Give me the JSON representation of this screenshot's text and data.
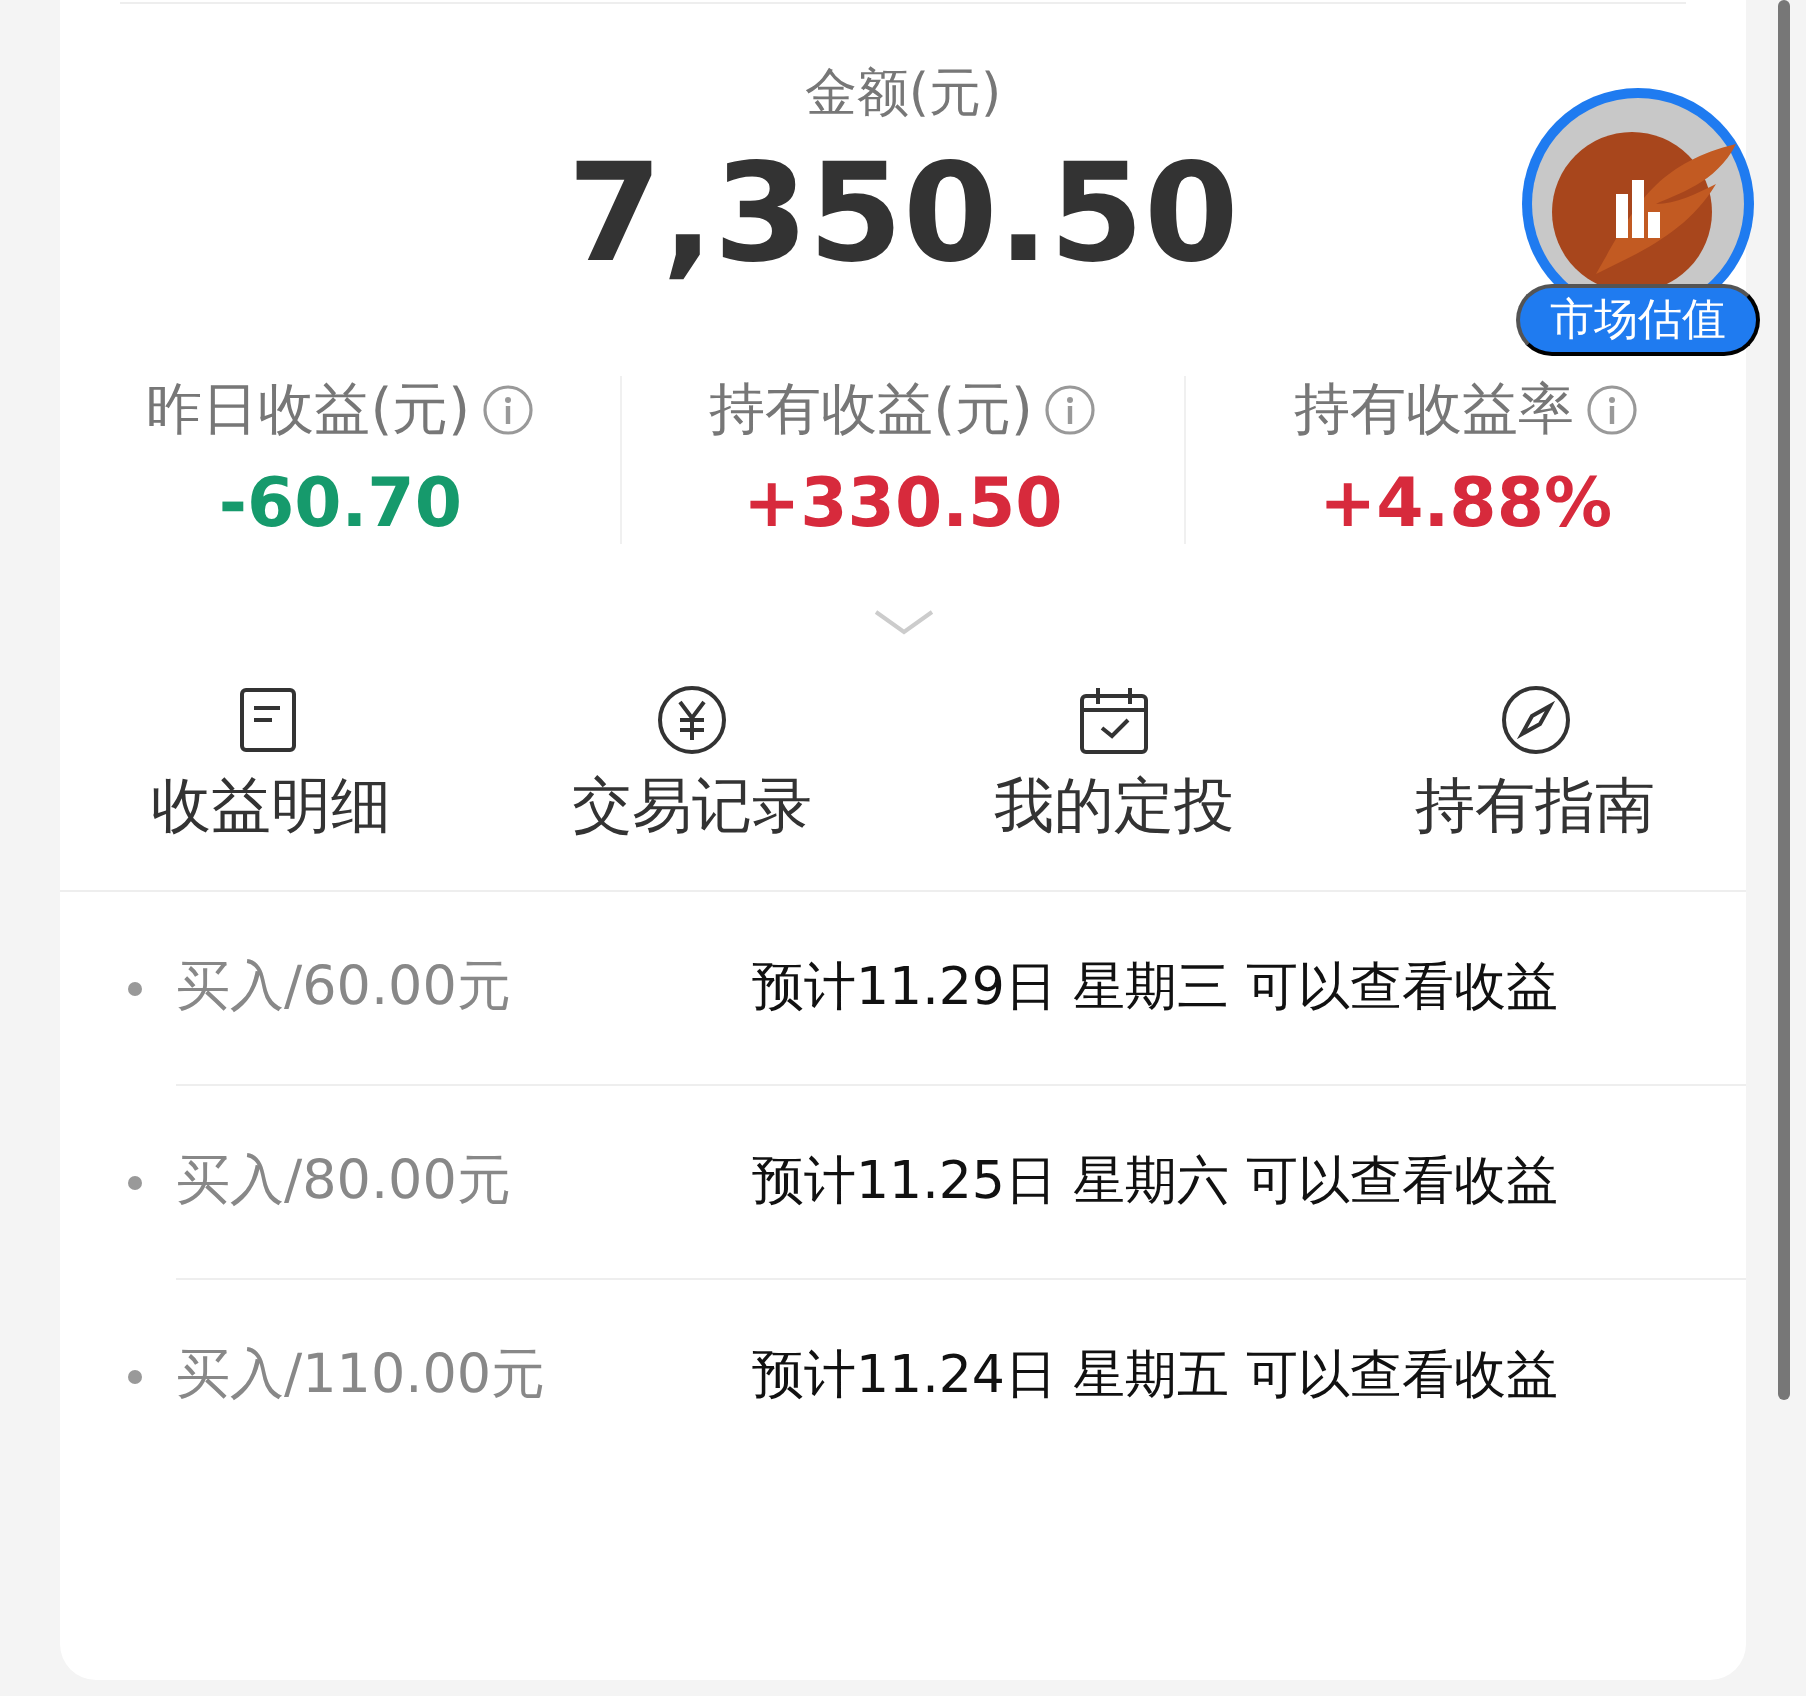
{
  "amount": {
    "label": "金额(元)",
    "value": "7,350.50"
  },
  "badge": {
    "label": "市场估值"
  },
  "stats": [
    {
      "label": "昨日收益(元)",
      "value": "-60.70",
      "color": "#169a6c"
    },
    {
      "label": "持有收益(元)",
      "value": "+330.50",
      "color": "#d72a3c"
    },
    {
      "label": "持有收益率",
      "value": "+4.88%",
      "color": "#d72a3c"
    }
  ],
  "actions": [
    {
      "label": "收益明细",
      "kind": "document"
    },
    {
      "label": "交易记录",
      "kind": "yen"
    },
    {
      "label": "我的定投",
      "kind": "calendar"
    },
    {
      "label": "持有指南",
      "kind": "compass"
    }
  ],
  "records": [
    {
      "title": "买入/60.00元",
      "note": "预计11.29日 星期三 可以查看收益"
    },
    {
      "title": "买入/80.00元",
      "note": "预计11.25日 星期六 可以查看收益"
    },
    {
      "title": "买入/110.00元",
      "note": "预计11.24日 星期五 可以查看收益"
    }
  ]
}
